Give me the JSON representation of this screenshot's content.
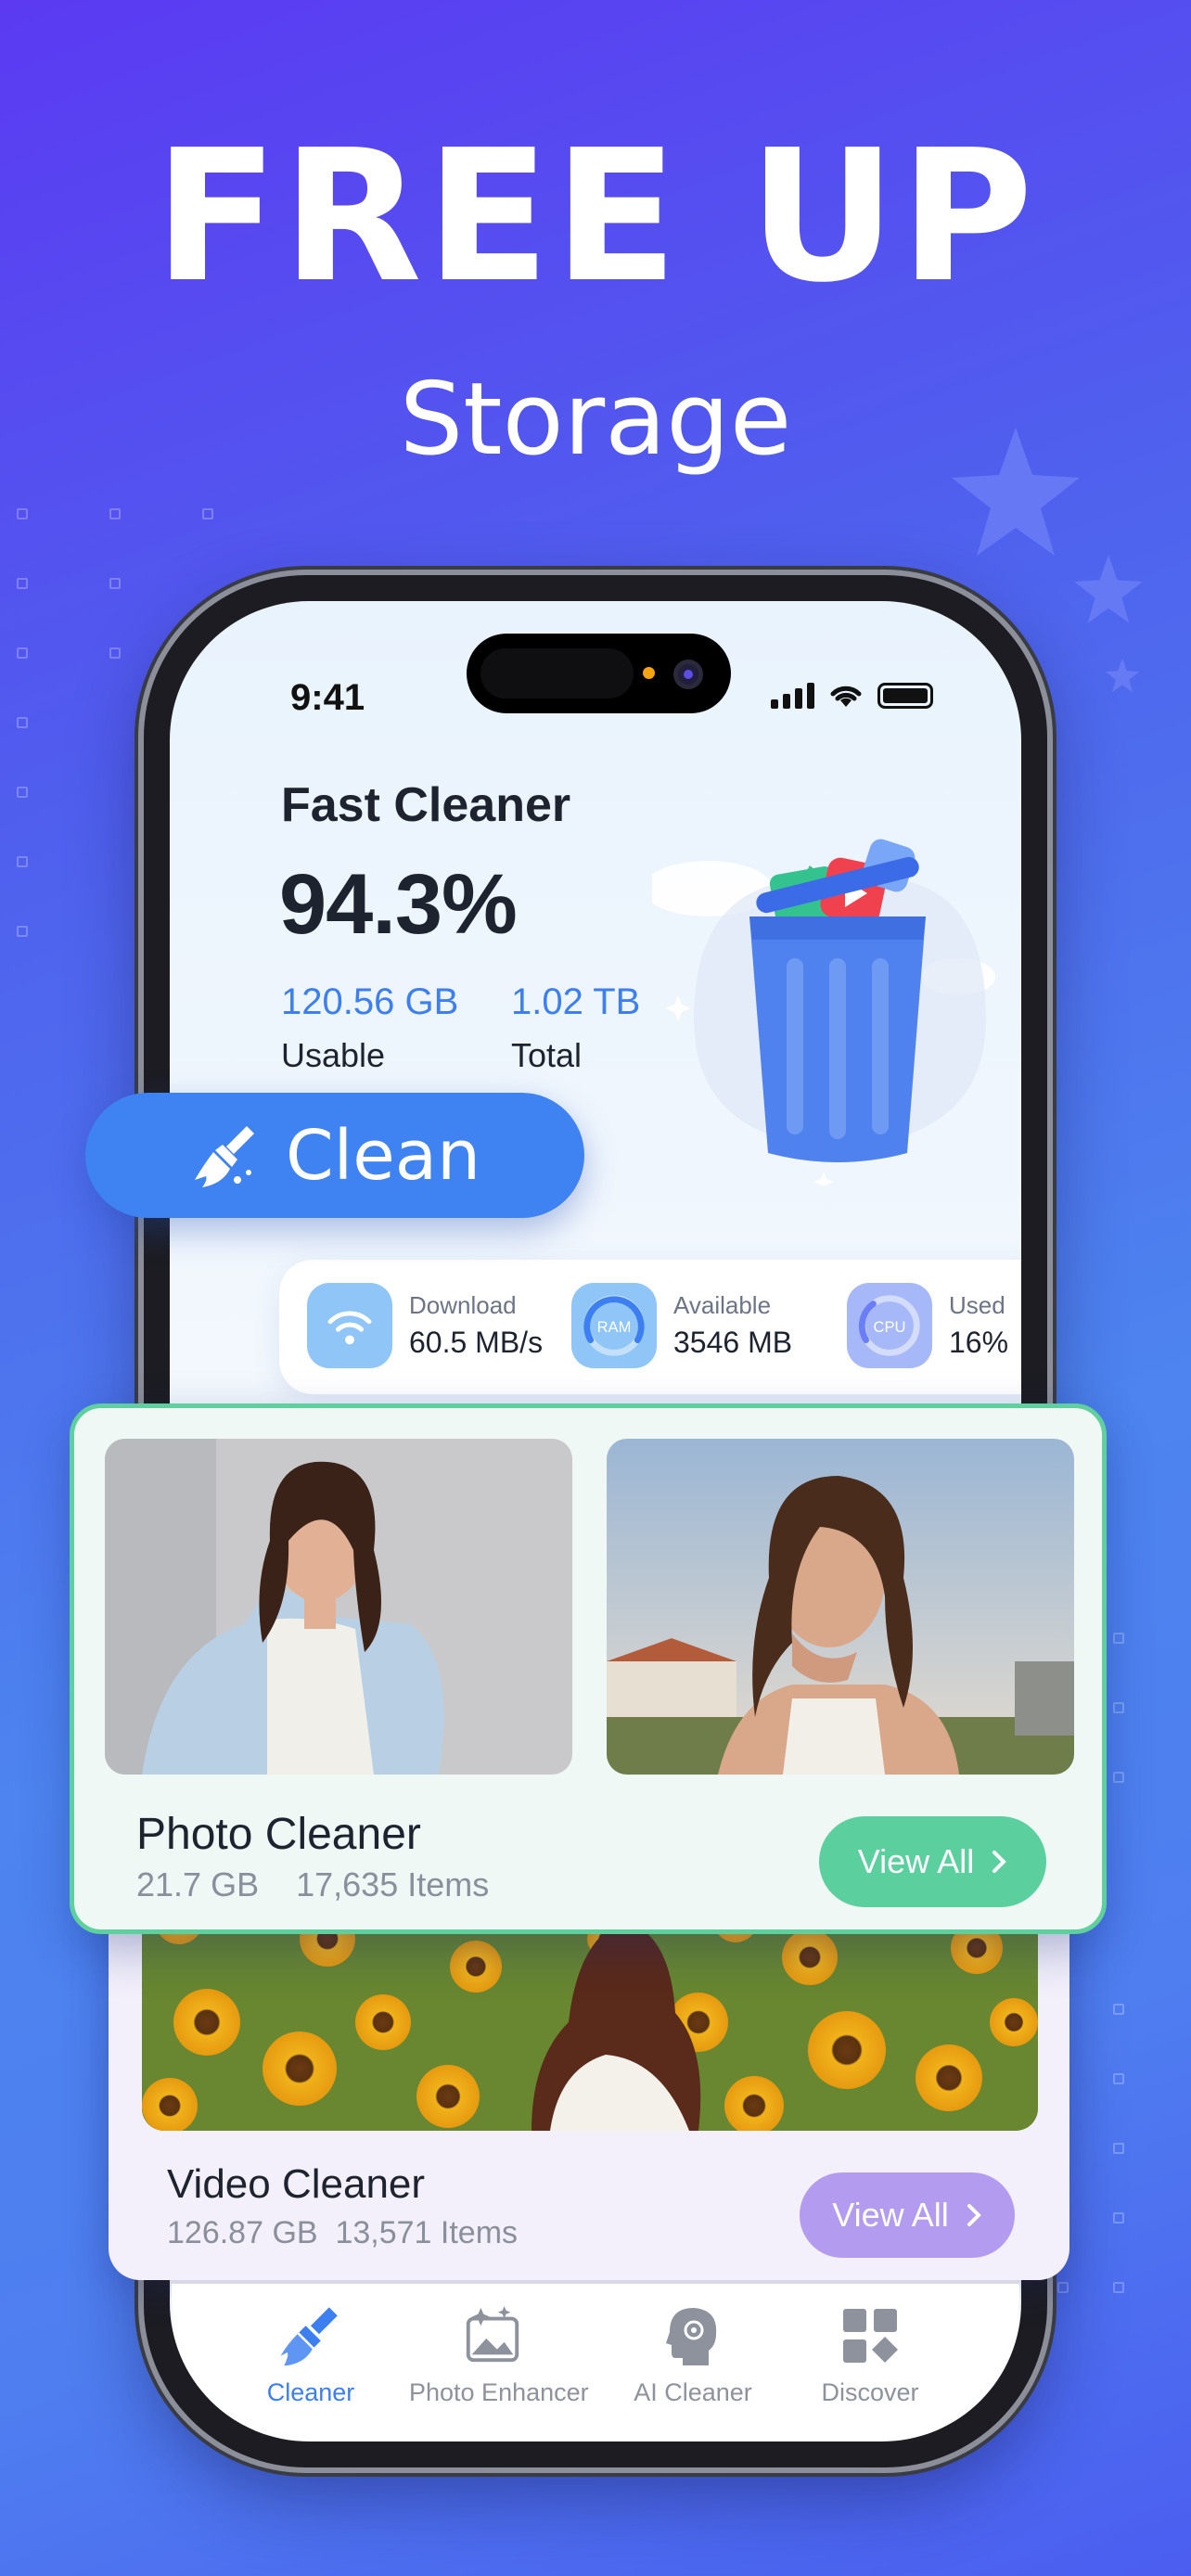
{
  "promo": {
    "headline": "FREE UP",
    "subheadline": "Storage"
  },
  "status_bar": {
    "time": "9:41"
  },
  "app": {
    "title": "Fast Cleaner",
    "usage_percent": "94.3%",
    "usable_value": "120.56 GB",
    "usable_label": "Usable",
    "total_value": "1.02 TB",
    "total_label": "Total",
    "clean_button": "Clean"
  },
  "metrics": [
    {
      "label": "Download",
      "value": "60.5 MB/s",
      "icon": "wifi-icon"
    },
    {
      "label": "Available",
      "value": "3546 MB",
      "icon": "ram-gauge-icon",
      "badge": "RAM"
    },
    {
      "label": "Used",
      "value": "16%",
      "icon": "cpu-gauge-icon",
      "badge": "CPU"
    }
  ],
  "photo_cleaner": {
    "title": "Photo Cleaner",
    "size": "21.7 GB",
    "items": "17,635 Items",
    "button": "View All"
  },
  "video_cleaner": {
    "title": "Video Cleaner",
    "size": "126.87 GB",
    "items": "13,571 Items",
    "button": "View All"
  },
  "tabs": [
    {
      "label": "Cleaner",
      "icon": "broom-icon",
      "active": true
    },
    {
      "label": "Photo Enhancer",
      "icon": "photo-sparkle-icon",
      "active": false
    },
    {
      "label": "AI Cleaner",
      "icon": "ai-head-icon",
      "active": false
    },
    {
      "label": "Discover",
      "icon": "grid-diamond-icon",
      "active": false
    }
  ],
  "colors": {
    "accent_blue": "#3f82f2",
    "photo_accent": "#5ccf9f",
    "video_accent": "#b39cf0"
  }
}
